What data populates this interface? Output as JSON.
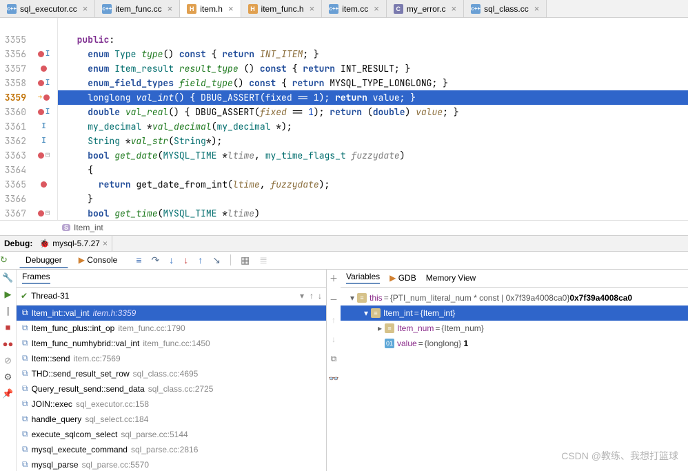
{
  "fileTabs": [
    {
      "icon": "cpp",
      "name": "sql_executor.cc",
      "active": false
    },
    {
      "icon": "cpp",
      "name": "item_func.cc",
      "active": false
    },
    {
      "icon": "h",
      "name": "item.h",
      "active": true
    },
    {
      "icon": "h",
      "name": "item_func.h",
      "active": false
    },
    {
      "icon": "cpp",
      "name": "item.cc",
      "active": false
    },
    {
      "icon": "c",
      "name": "my_error.c",
      "active": false
    },
    {
      "icon": "cpp",
      "name": "sql_class.cc",
      "active": false
    }
  ],
  "code": {
    "lines": [
      {
        "n": "",
        "gutter": "",
        "html": ""
      },
      {
        "n": "3355",
        "gutter": "",
        "html": "  <span class='pub'>public</span>:"
      },
      {
        "n": "3356",
        "gutter": "bp impl",
        "html": "    <span class='kw'>enum</span> <span class='type'>Type</span> <span class='fn'>type</span>() <span class='kw'>const</span> { <span class='kw'>return</span> <span class='id'>INT_ITEM</span>; }"
      },
      {
        "n": "3357",
        "gutter": "bp",
        "html": "    <span class='kw'>enum</span> <span class='type'>Item_result</span> <span class='fn'>result_type</span> () <span class='kw'>const</span> { <span class='kw'>return</span> INT_RESULT; }"
      },
      {
        "n": "3358",
        "gutter": "bp impl",
        "html": "    <span class='kw'>enum_field_types</span> <span class='fn'>field_type</span>() <span class='kw'>const</span> { <span class='kw'>return</span> MYSQL_TYPE_LONGLONG; }"
      },
      {
        "n": "3359",
        "gutter": "ex bp",
        "hl": true,
        "html": "    <span class='type'>longlong</span> <span class='fn'>val_int</span>() { DBUG_ASSERT(fixed == <span class='num'>1</span>); <span class='kw'>return</span> value; }"
      },
      {
        "n": "3360",
        "gutter": "bp impl",
        "html": "    <span class='kw'>double</span> <span class='fn'>val_real</span>() { DBUG_ASSERT(<span class='id'>fixed</span> == <span class='num'>1</span>); <span class='kw'>return</span> (<span class='kw'>double</span>) <span class='id'>value</span>; }"
      },
      {
        "n": "3361",
        "gutter": "impl",
        "html": "    <span class='type'>my_decimal</span> *<span class='fn'>val_decimal</span>(<span class='type'>my_decimal</span> *);"
      },
      {
        "n": "3362",
        "gutter": "impl",
        "html": "    <span class='type'>String</span> *<span class='fn'>val_str</span>(<span class='type'>String</span>*);"
      },
      {
        "n": "3363",
        "gutter": "bp fold",
        "html": "    <span class='kw'>bool</span> <span class='fn'>get_date</span>(<span class='type'>MYSQL_TIME</span> *<span class='param'>ltime</span>, <span class='type'>my_time_flags_t</span> <span class='param'>fuzzydate</span>)"
      },
      {
        "n": "3364",
        "gutter": "",
        "html": "    {"
      },
      {
        "n": "3365",
        "gutter": "bp",
        "html": "      <span class='kw'>return</span> get_date_from_int(<span class='id'>ltime</span>, <span class='id'>fuzzydate</span>);"
      },
      {
        "n": "3366",
        "gutter": "",
        "html": "    }"
      },
      {
        "n": "3367",
        "gutter": "bp fold",
        "html": "    <span class='kw'>bool</span> <span class='fn'>get_time</span>(<span class='type'>MYSQL_TIME</span> *<span class='param'>ltime</span>)"
      }
    ]
  },
  "breadcrumb": {
    "struct": "Item_int"
  },
  "debug": {
    "title": "Debug:",
    "config": "mysql-5.7.27",
    "tabs": {
      "debugger": "Debugger",
      "console": "Console"
    },
    "framesTitle": "Frames",
    "varsTabs": {
      "variables": "Variables",
      "gdb": "GDB",
      "memory": "Memory View"
    },
    "thread": "Thread-31",
    "frames": [
      {
        "fn": "Item_int::val_int",
        "loc": "item.h:3359",
        "sel": true
      },
      {
        "fn": "Item_func_plus::int_op",
        "loc": "item_func.cc:1790"
      },
      {
        "fn": "Item_func_numhybrid::val_int",
        "loc": "item_func.cc:1450"
      },
      {
        "fn": "Item::send",
        "loc": "item.cc:7569"
      },
      {
        "fn": "THD::send_result_set_row",
        "loc": "sql_class.cc:4695"
      },
      {
        "fn": "Query_result_send::send_data",
        "loc": "sql_class.cc:2725"
      },
      {
        "fn": "JOIN::exec",
        "loc": "sql_executor.cc:158"
      },
      {
        "fn": "handle_query",
        "loc": "sql_select.cc:184"
      },
      {
        "fn": "execute_sqlcom_select",
        "loc": "sql_parse.cc:5144"
      },
      {
        "fn": "mysql_execute_command",
        "loc": "sql_parse.cc:2816"
      },
      {
        "fn": "mysql_parse",
        "loc": "sql_parse.cc:5570"
      }
    ],
    "vars": [
      {
        "depth": 0,
        "arrow": "▾",
        "kind": "obj",
        "name": "this",
        "value": "{PTI_num_literal_num * const | 0x7f39a4008ca0}",
        "extra": "0x7f39a4008ca0"
      },
      {
        "depth": 1,
        "arrow": "▾",
        "kind": "obj",
        "name": "Item_int",
        "value": "{Item_int}",
        "hl": true
      },
      {
        "depth": 2,
        "arrow": "▸",
        "kind": "obj",
        "name": "Item_num",
        "value": "{Item_num}"
      },
      {
        "depth": 2,
        "arrow": "",
        "kind": "val",
        "name": "value",
        "value": "{longlong} 1",
        "bold": "1"
      }
    ]
  },
  "watermark": "CSDN @教练、我想打篮球"
}
